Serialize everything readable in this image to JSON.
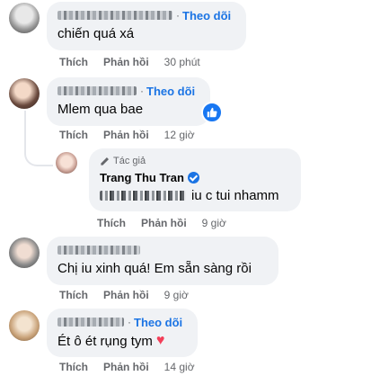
{
  "colors": {
    "accent": "#1b74e4",
    "bubble": "#f0f2f5",
    "meta": "#65676b",
    "heart": "#f33e58"
  },
  "comments": [
    {
      "text": "chiến quá xá",
      "follow": "Theo dõi",
      "like": "Thích",
      "reply": "Phản hồi",
      "time": "30 phút"
    },
    {
      "text": "Mlem qua bae",
      "follow": "Theo dõi",
      "like": "Thích",
      "reply": "Phản hồi",
      "time": "12 giờ"
    },
    {
      "author_tag": "Tác giả",
      "name": "Trang Thu Tran",
      "text": "iu c tui nhamm",
      "like": "Thích",
      "reply": "Phản hồi",
      "time": "9 giờ"
    },
    {
      "text": "Chị iu xinh quá! Em sẵn sàng rồi",
      "like": "Thích",
      "reply": "Phản hồi",
      "time": "9 giờ"
    },
    {
      "text": "Ét ô ét rụng tym",
      "follow": "Theo dõi",
      "like": "Thích",
      "reply": "Phản hồi",
      "time": "14 giờ"
    }
  ]
}
